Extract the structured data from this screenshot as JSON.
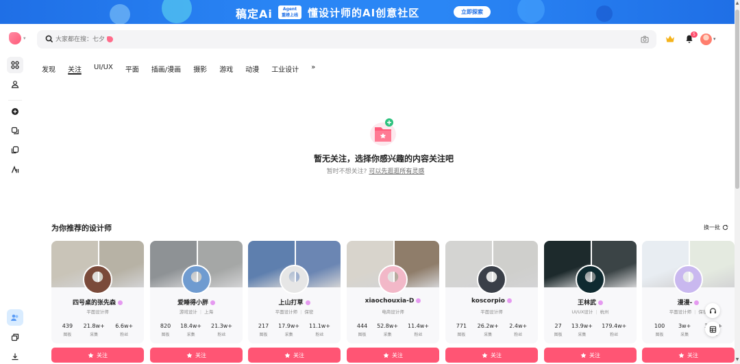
{
  "banner": {
    "brand": "稿定Ai",
    "badge_line1": "Agent",
    "badge_line2": "重磅上线",
    "slogan": "懂设计师的AI创意社区",
    "button": "立即探索"
  },
  "header": {
    "search_placeholder": "大家都在搜：七夕",
    "notification_count": "5"
  },
  "tabs": [
    {
      "label": "发现",
      "active": false
    },
    {
      "label": "关注",
      "active": true
    },
    {
      "label": "UI/UX",
      "active": false
    },
    {
      "label": "平面",
      "active": false
    },
    {
      "label": "插画/漫画",
      "active": false
    },
    {
      "label": "摄影",
      "active": false
    },
    {
      "label": "游戏",
      "active": false
    },
    {
      "label": "动漫",
      "active": false
    },
    {
      "label": "工业设计",
      "active": false
    },
    {
      "label": "»",
      "active": false
    }
  ],
  "empty": {
    "title": "暂无关注，选择你感兴趣的内容关注吧",
    "sub_prefix": "暂时不想关注?",
    "sub_link": "可以先逛逛所有灵感"
  },
  "recommend": {
    "title": "为你推荐的设计师",
    "refresh_label": "换一批",
    "follow_label": "关注",
    "stat_labels": [
      "图板",
      "采集",
      "粉丝"
    ],
    "designers": [
      {
        "name": "四号桌的张先森",
        "meta": [
          "平面设计师"
        ],
        "stats": [
          "439",
          "21.8w+",
          "6.6w+"
        ],
        "cover": [
          "#c9c4b8",
          "#b7b2a5"
        ],
        "avatar": "#7a4a3a"
      },
      {
        "name": "爱睡得小胖",
        "meta": [
          "游戏设计",
          "上海"
        ],
        "stats": [
          "820",
          "18.4w+",
          "21.3w+"
        ],
        "cover": [
          "#8e9295",
          "#a5a7a6"
        ],
        "avatar": "#6f9bd0"
      },
      {
        "name": "上山打草",
        "meta": [
          "平面设计师",
          "保密"
        ],
        "stats": [
          "217",
          "17.9w+",
          "11.1w+"
        ],
        "cover": [
          "#5e7fae",
          "#6b86b3"
        ],
        "avatar": "#e6e6e6"
      },
      {
        "name": "xiaochouxia-D",
        "meta": [
          "电商设计师"
        ],
        "stats": [
          "444",
          "52.8w+",
          "11.4w+"
        ],
        "cover": [
          "#d8d4cc",
          "#8f7d6a"
        ],
        "avatar": "#f2b8c8"
      },
      {
        "name": "koscorpio",
        "meta": [
          "平面设计师"
        ],
        "stats": [
          "771",
          "26.2w+",
          "2.4w+"
        ],
        "cover": [
          "#d4d4d2",
          "#cfcfcc"
        ],
        "avatar": "#3a3f48"
      },
      {
        "name": "王林武",
        "meta": [
          "UI/UX设计",
          "杭州"
        ],
        "stats": [
          "27",
          "13.9w+",
          "179.4w+"
        ],
        "cover": [
          "#1d2a2c",
          "#3b4446"
        ],
        "avatar": "#0f2a30"
      },
      {
        "name": "漫漫-",
        "meta": [
          "平面设计师",
          "保密"
        ],
        "stats": [
          "100",
          "3w+",
          "3.6w+"
        ],
        "cover": [
          "#e8edf2",
          "#e4eae0"
        ],
        "avatar": "#c9b8ef"
      }
    ]
  },
  "colors": {
    "brand": "#ff5574",
    "banner": "#2a86f5"
  }
}
